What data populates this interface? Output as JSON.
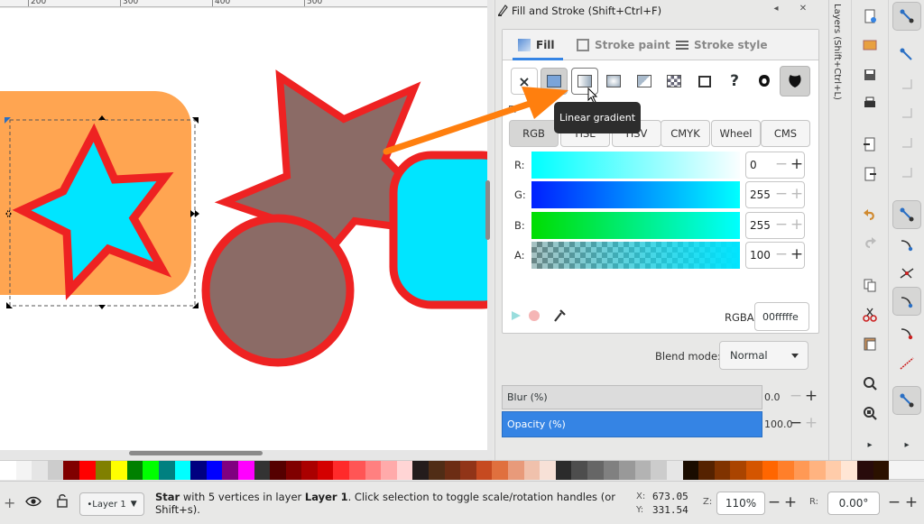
{
  "ruler": {
    "marks": [
      "200",
      "300",
      "400",
      "500"
    ]
  },
  "dialog": {
    "title": "Fill and Stroke (Shift+Ctrl+F)",
    "tabs": [
      {
        "label": "Fill",
        "active": true
      },
      {
        "label": "Stroke paint",
        "active": false
      },
      {
        "label": "Stroke style",
        "active": false
      }
    ],
    "paint_types": [
      "no-paint",
      "flat-color",
      "linear-gradient",
      "radial-gradient",
      "mesh-gradient",
      "pattern",
      "swatch",
      "unset",
      "fill-rule-evenodd",
      "fill-rule-nonzero"
    ],
    "paint_glyphs": {
      "none": "×",
      "unset": "?"
    },
    "tooltip": "Linear gradient",
    "fl_label": "Fl",
    "color_modes": [
      "RGB",
      "HSL",
      "HSV",
      "CMYK",
      "Wheel",
      "CMS"
    ],
    "active_mode": "RGB",
    "channels": [
      {
        "label": "R:",
        "value": "0"
      },
      {
        "label": "G:",
        "value": "255"
      },
      {
        "label": "B:",
        "value": "255"
      },
      {
        "label": "A:",
        "value": "100"
      }
    ],
    "rgba_label": "RGBA:",
    "rgba_value": "00fffffe",
    "blend_label": "Blend mode:",
    "blend_value": "Normal",
    "blur_label": "Blur (%)",
    "blur_value": "0.0",
    "opacity_label": "Opacity (%)",
    "opacity_value": "100.0"
  },
  "layers_panel": {
    "label": "Layers (Shift+Ctrl+L)"
  },
  "statusbar": {
    "layer": "•Layer 1",
    "message_bold1": "Star",
    "message_part1": " with 5 vertices in layer ",
    "message_bold2": "Layer 1",
    "message_part2": ". Click selection to toggle scale/rotation handles (or Shift+s).",
    "x_label": "X:",
    "x_value": "673.05",
    "y_label": "Y:",
    "y_value": "331.54",
    "zoom_label": "Z:",
    "zoom_value": "110%",
    "rotation_label": "R:",
    "rotation_value": "0.00°"
  },
  "colors": {
    "accent": "#3584e4",
    "shape_orange": "#ffa551",
    "shape_cyan": "#00e5ff",
    "shape_brown": "#8b6b66",
    "shape_stroke": "#ee2222",
    "annotation_arrow": "#ff7f0e"
  },
  "palette": [
    "#ffffff",
    "#f4f4f4",
    "#e5e5e5",
    "#cccccc",
    "#800000",
    "#ff0000",
    "#808000",
    "#ffff00",
    "#008000",
    "#00ff00",
    "#008080",
    "#00ffff",
    "#000080",
    "#0000ff",
    "#800080",
    "#ff00ff",
    "#333333",
    "#550000",
    "#800000",
    "#aa0000",
    "#d40000",
    "#ff2a2a",
    "#ff5555",
    "#ff8080",
    "#ffaaaa",
    "#ffd5d5",
    "#241c1c",
    "#502d16",
    "#6c2d14",
    "#913418",
    "#c64a20",
    "#e0703e",
    "#e89a7a",
    "#f0c1ac",
    "#f7e1d7",
    "#2b2b2b",
    "#4d4d4d",
    "#666666",
    "#808080",
    "#999999",
    "#b3b3b3",
    "#cccccc",
    "#e6e6e6",
    "#1a0c00",
    "#552200",
    "#803300",
    "#aa4400",
    "#d45500",
    "#ff6600",
    "#ff7f2a",
    "#ff9955",
    "#ffb380",
    "#ffccaa",
    "#ffe6d5",
    "#280b0b",
    "#2b1100"
  ]
}
